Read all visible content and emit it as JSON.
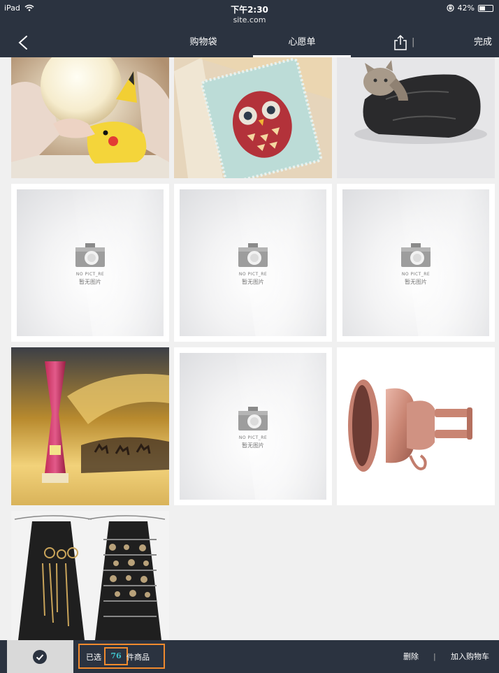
{
  "status_bar": {
    "device": "iPad",
    "time": "下午2:30",
    "url": "site.com",
    "battery": "42%",
    "battery_level": 0.42
  },
  "nav": {
    "tabs": [
      {
        "label": "购物袋"
      },
      {
        "label": "心愿单"
      }
    ],
    "active_tab": 1,
    "done_label": "完成",
    "separator": "|"
  },
  "products": [
    {
      "name": "pikachu-lamp"
    },
    {
      "name": "owl-notebook"
    },
    {
      "name": "cat-grooming-bag"
    },
    {
      "name": "no-picture",
      "placeholder_en": "NO PICT_RE",
      "placeholder_cn": "暂无图片"
    },
    {
      "name": "no-picture",
      "placeholder_en": "NO PICT_RE",
      "placeholder_cn": "暂无图片"
    },
    {
      "name": "no-picture",
      "placeholder_en": "NO PICT_RE",
      "placeholder_cn": "暂无图片"
    },
    {
      "name": "sand-hourglass-lamp"
    },
    {
      "name": "no-picture",
      "placeholder_en": "NO PICT_RE",
      "placeholder_cn": "暂无图片"
    },
    {
      "name": "magnetic-car-phone-holder"
    },
    {
      "name": "hanging-jewelry-organizer"
    }
  ],
  "bottom_bar": {
    "selected_prefix": "已选",
    "selected_count": "76",
    "selected_suffix": "件商品",
    "delete_label": "删除",
    "separator": "|",
    "add_to_cart_label": "加入购物车"
  },
  "colors": {
    "bar": "#2b3340",
    "highlight": "#f08a2e",
    "count_text": "#3fc0c8"
  }
}
